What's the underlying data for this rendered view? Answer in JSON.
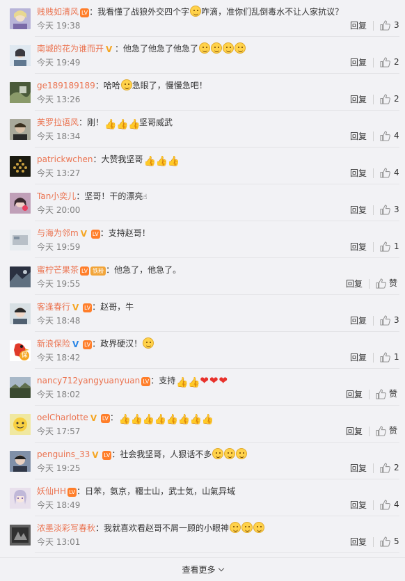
{
  "comments": [
    {
      "user": "贱贱如清风",
      "content": "：我看懂了战狼外交四个字",
      "content2": "咋滴，准你们乱倒毒水不让人家抗议？",
      "time": "今天 19:38",
      "reply": "回复",
      "likes": "3",
      "avatar_color": "#b8b4d8"
    },
    {
      "user": "南城的花为谁而开",
      "content": "：他急了他急了他急了",
      "content2": "",
      "time": "今天 19:49",
      "reply": "回复",
      "likes": "2",
      "avatar_color": "#8ab0c8"
    },
    {
      "user": "ge189189189",
      "content": "：哈哈",
      "content2": "急眼了，慢慢急吧！",
      "time": "今天 13:26",
      "reply": "回复",
      "likes": "2",
      "avatar_color": "#6a7a5a"
    },
    {
      "user": "芙罗拉语风",
      "content": "：刚！",
      "content2": "坚哥威武",
      "time": "今天 18:34",
      "reply": "回复",
      "likes": "4",
      "avatar_color": "#9a9a8a"
    },
    {
      "user": "patrickwchen",
      "content": "：大赞我坚哥",
      "content2": "",
      "time": "今天 13:27",
      "reply": "回复",
      "likes": "4",
      "avatar_color": "#5a4a20"
    },
    {
      "user": "Tan小奕儿",
      "content": "：坚哥！干的漂亮",
      "content2": "",
      "time": "今天 20:00",
      "reply": "回复",
      "likes": "3",
      "avatar_color": "#c87a8a"
    },
    {
      "user": "与海为邻m",
      "content": "：支持赵哥！",
      "content2": "",
      "time": "今天 19:59",
      "reply": "回复",
      "likes": "1",
      "avatar_color": "#d0d4d8"
    },
    {
      "user": "蜜柠芒果茶",
      "content": "：他急了，他急了。",
      "content2": "",
      "time": "今天 19:55",
      "reply": "回复",
      "likes": "赞",
      "avatar_color": "#3a4a5a"
    },
    {
      "user": "客逢春行",
      "content": "：赵哥，牛",
      "content2": "",
      "time": "今天 18:48",
      "reply": "回复",
      "likes": "3",
      "avatar_color": "#b8c4c8"
    },
    {
      "user": "新浪保险",
      "content": "：政界硬汉！",
      "content2": "",
      "time": "今天 18:42",
      "reply": "回复",
      "likes": "1",
      "avatar_color": "#ffffff"
    },
    {
      "user": "nancy712yangyuanyuan",
      "content": "：支持",
      "content2": "",
      "time": "今天 18:02",
      "reply": "回复",
      "likes": "赞",
      "avatar_color": "#7a8a70"
    },
    {
      "user": "oelCharlotte",
      "content": "：",
      "content2": "",
      "time": "今天 17:57",
      "reply": "回复",
      "likes": "赞",
      "avatar_color": "#e8d870"
    },
    {
      "user": "penguins_33",
      "content": "：社会我坚哥，人狠话不多",
      "content2": "",
      "time": "今天 19:25",
      "reply": "回复",
      "likes": "2",
      "avatar_color": "#5a6a80"
    },
    {
      "user": "妖仙HH",
      "content": "：日苯，氨京，韁士山，武士気，山氣异域",
      "content2": "",
      "time": "今天 18:49",
      "reply": "回复",
      "likes": "4",
      "avatar_color": "#d8c8d8"
    },
    {
      "user": "浓墨淡彩写春秋",
      "content": "：我就喜欢看赵哥不屑一顾的小眼神",
      "content2": "",
      "time": "今天 13:01",
      "reply": "回复",
      "likes": "5",
      "avatar_color": "#4a4a4a"
    }
  ],
  "fan_badge": "铁粉",
  "insurance_badge": "保",
  "load_more": "查看更多",
  "colors": {
    "username": "#eb7350",
    "time": "#808080",
    "background": "#f2f2f5"
  }
}
